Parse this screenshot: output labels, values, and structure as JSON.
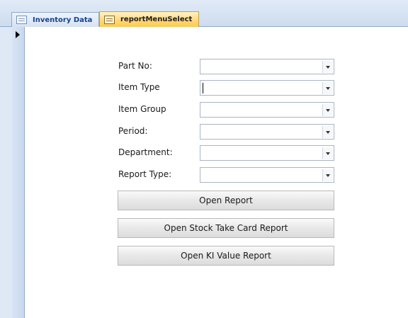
{
  "tabs": [
    {
      "label": "Inventory Data",
      "active": false
    },
    {
      "label": "reportMenuSelect",
      "active": true
    }
  ],
  "form": {
    "fields": [
      {
        "label": "Part No:",
        "value": ""
      },
      {
        "label": "Item Type",
        "value": ""
      },
      {
        "label": "Item Group",
        "value": ""
      },
      {
        "label": "Period:",
        "value": ""
      },
      {
        "label": "Department:",
        "value": ""
      },
      {
        "label": "Report Type:",
        "value": ""
      }
    ],
    "buttons": {
      "open_report": "Open Report",
      "open_stock_take": "Open Stock Take Card Report",
      "open_ki_value": "Open KI Value Report"
    }
  },
  "colors": {
    "active_tab": "#ffd677",
    "tab_strip": "#dbe6f4",
    "tab_text": "#15428b"
  },
  "icons": [
    "form-icon",
    "record-selector-arrow-icon",
    "dropdown-chevron-icon"
  ]
}
